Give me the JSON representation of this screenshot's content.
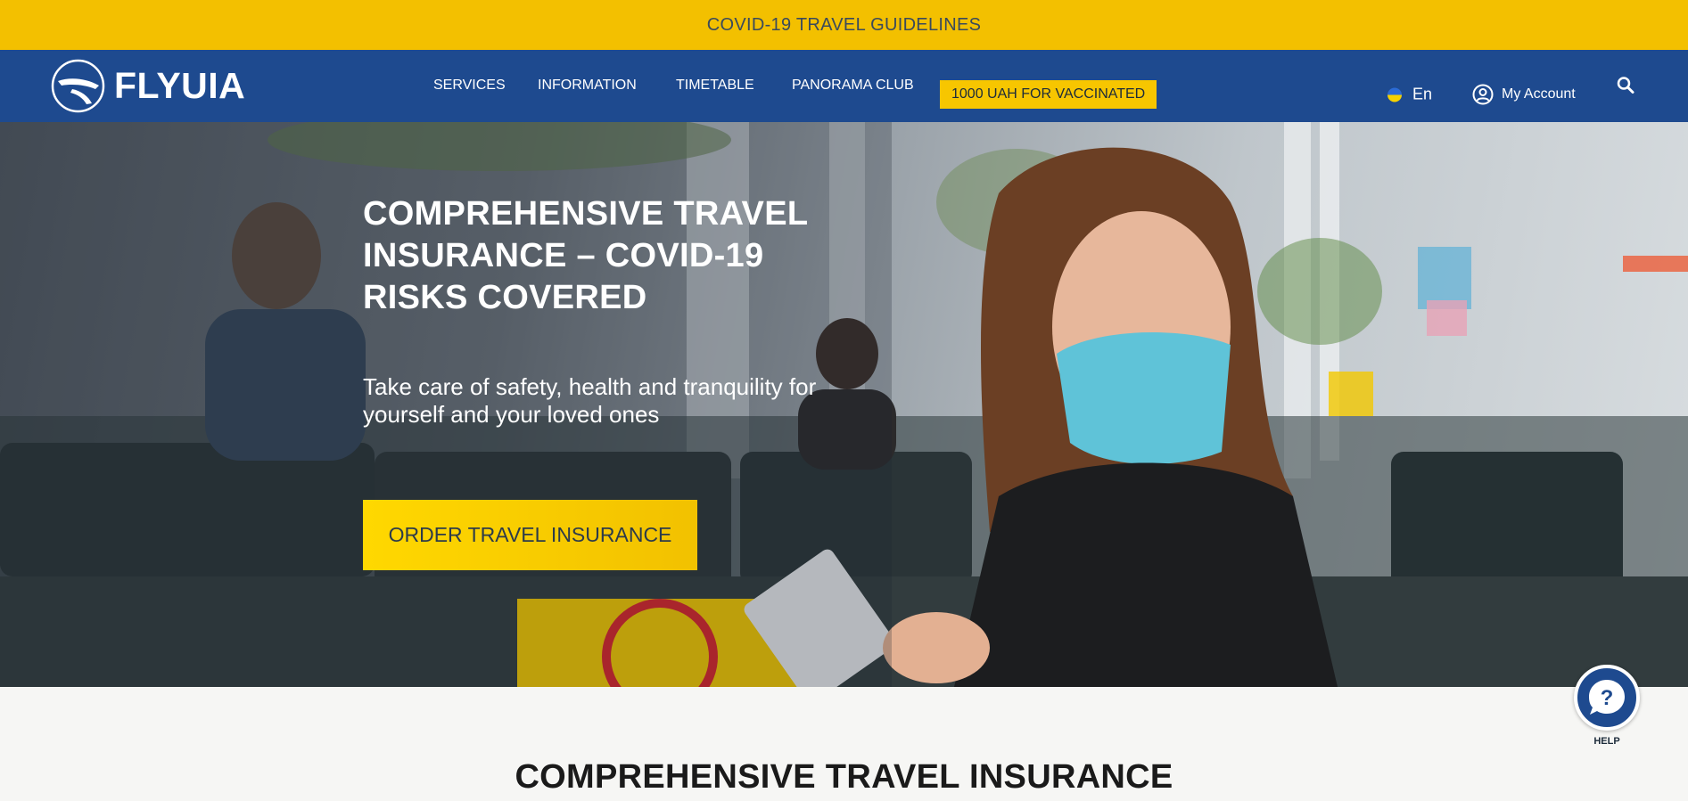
{
  "topbar": {
    "text": "COVID-19 TRAVEL GUIDELINES"
  },
  "brand": {
    "name": "FLYUIA",
    "color": "#1e4a8f",
    "accent": "#f3c000"
  },
  "nav": {
    "items": [
      {
        "label": "SERVICES"
      },
      {
        "label": "INFORMATION"
      },
      {
        "label": "TIMETABLE"
      },
      {
        "label": "PANORAMA CLUB"
      }
    ],
    "promo": {
      "label": "1000 UAH FOR VACCINATED"
    }
  },
  "header": {
    "language": "En",
    "account_label": "My Account",
    "search_icon": "search-icon"
  },
  "hero": {
    "title": "COMPREHENSIVE TRAVEL INSURANCE – COVID-19 RISKS COVERED",
    "subtitle": "Take care of safety, health and tranquility for yourself and your loved ones",
    "cta_label": "ORDER TRAVEL INSURANCE"
  },
  "section": {
    "title": "COMPREHENSIVE TRAVEL INSURANCE"
  },
  "help": {
    "label": "HELP"
  }
}
